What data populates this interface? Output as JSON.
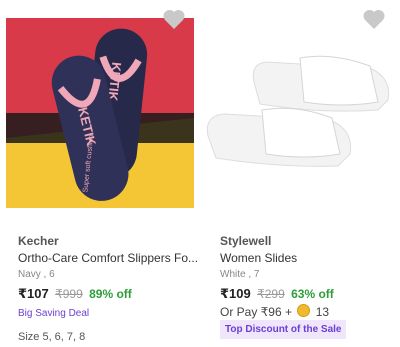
{
  "products": [
    {
      "brand": "Kecher",
      "title": "Ortho-Care Comfort Slippers Fo...",
      "meta": "Navy , 6",
      "price": "₹107",
      "mrp": "₹999",
      "discount": "89% off",
      "deal": "Big Saving Deal",
      "sizes": "Size 5, 6, 7, 8",
      "image_text": {
        "strap_word": "KETIK",
        "sole_text": "Super soft cushion"
      },
      "colors": {
        "background": "#d93a49",
        "floor": "#f4c534",
        "slipper": "#27294a",
        "strap": "#f0a8b8"
      }
    },
    {
      "brand": "Stylewell",
      "title": "Women Slides",
      "meta": "White , 7",
      "price": "₹109",
      "mrp": "₹299",
      "discount": "63% off",
      "pay": {
        "prefix": "Or Pay ₹96 +",
        "coins": "13"
      },
      "deal": "Top Discount of the Sale"
    }
  ]
}
